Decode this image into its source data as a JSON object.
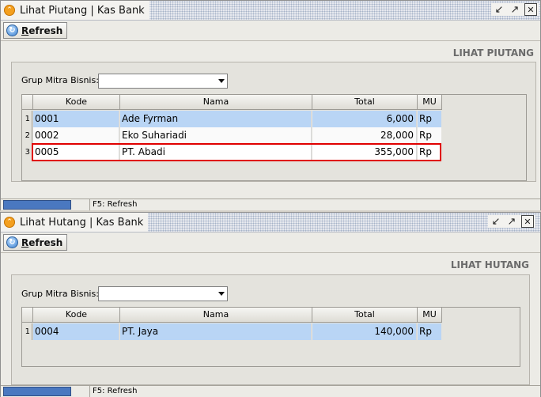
{
  "windows": [
    {
      "title": "Lihat Piutang | Kas Bank",
      "refresh_label": "Refresh",
      "heading": "LIHAT PIUTANG",
      "grup_label": "Grup Mitra Bisnis:",
      "grup_value": "",
      "columns": [
        "Kode",
        "Nama",
        "Total",
        "MU"
      ],
      "rows": [
        {
          "num": "1",
          "kode": "0001",
          "nama": "Ade Fyrman",
          "total": "6,000",
          "mu": "Rp"
        },
        {
          "num": "2",
          "kode": "0002",
          "nama": "Eko Suhariadi",
          "total": "28,000",
          "mu": "Rp"
        },
        {
          "num": "3",
          "kode": "0005",
          "nama": "PT. Abadi",
          "total": "355,000",
          "mu": "Rp"
        }
      ],
      "status": "F5: Refresh"
    },
    {
      "title": "Lihat Hutang | Kas Bank",
      "refresh_label": "Refresh",
      "heading": "LIHAT HUTANG",
      "grup_label": "Grup Mitra Bisnis:",
      "grup_value": "",
      "columns": [
        "Kode",
        "Nama",
        "Total",
        "MU"
      ],
      "rows": [
        {
          "num": "1",
          "kode": "0004",
          "nama": "PT. Jaya",
          "total": "140,000",
          "mu": "Rp"
        }
      ],
      "status": "F5: Refresh"
    }
  ],
  "icons": {
    "app": "orange-chevron-icon",
    "refresh": "refresh-icon",
    "minimize": "restore-icon",
    "maximize": "maximize-icon",
    "close": "close-icon"
  },
  "colors": {
    "selected_row": "#b9d5f5",
    "highlight": "#e00000",
    "status_progress": "#4a78c0"
  }
}
